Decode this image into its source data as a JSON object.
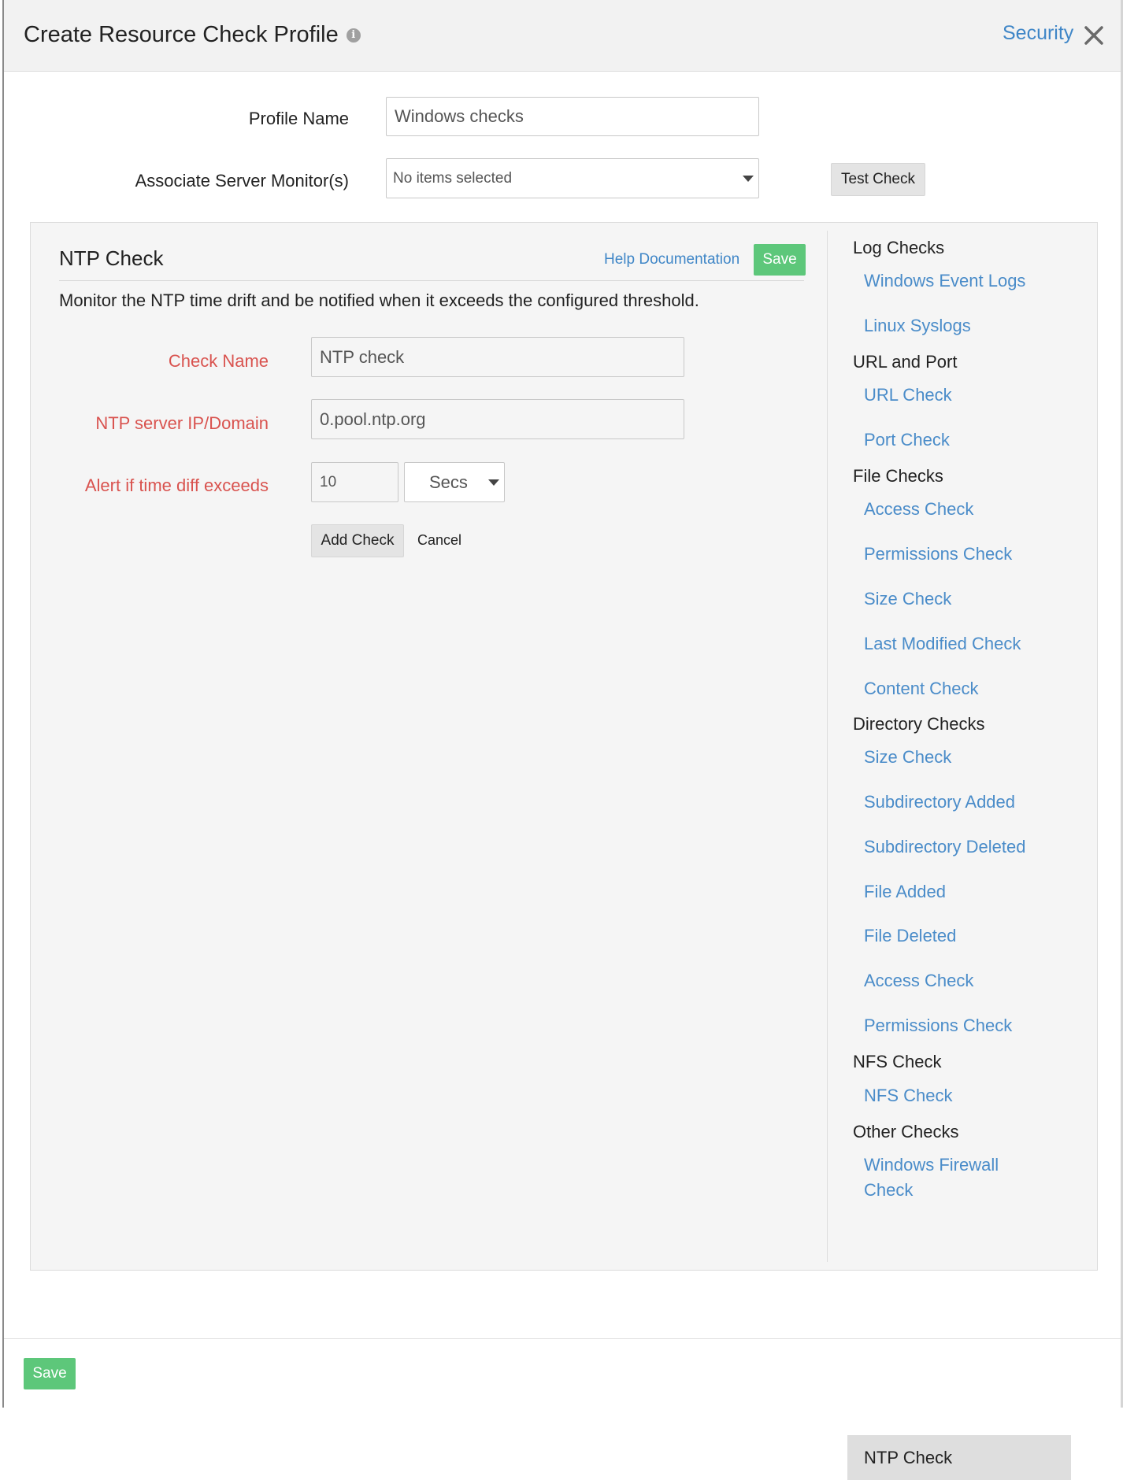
{
  "header": {
    "title": "Create Resource Check Profile",
    "info_icon": "i",
    "link": "Security"
  },
  "form": {
    "profile_name_label": "Profile Name",
    "profile_name_value": "Windows checks",
    "associate_label": "Associate Server Monitor(s)",
    "associate_value": "No items selected",
    "test_check_label": "Test Check"
  },
  "panel": {
    "title": "NTP Check",
    "help_link": "Help Documentation",
    "save_label": "Save",
    "description": "Monitor the NTP time drift and be notified when it exceeds the configured threshold.",
    "check_name_label": "Check Name",
    "check_name_value": "NTP check",
    "server_label": "NTP server IP/Domain",
    "server_value": "0.pool.ntp.org",
    "alert_label": "Alert if time diff exceeds",
    "alert_value": "10",
    "unit_value": "Secs",
    "add_check_label": "Add Check",
    "cancel_label": "Cancel"
  },
  "sidebar": {
    "groups": [
      {
        "label": "Log Checks",
        "items": [
          "Windows Event Logs",
          "Linux Syslogs"
        ]
      },
      {
        "label": "URL and Port",
        "items": [
          "URL Check",
          "Port Check"
        ]
      },
      {
        "label": "File Checks",
        "items": [
          "Access Check",
          "Permissions Check",
          "Size Check",
          "Last Modified Check",
          "Content Check"
        ]
      },
      {
        "label": "Directory Checks",
        "items": [
          "Size Check",
          "Subdirectory Added",
          "Subdirectory Deleted",
          "File Added",
          "File Deleted",
          "Access Check",
          "Permissions Check"
        ]
      },
      {
        "label": "NFS Check",
        "items": [
          "NFS Check"
        ]
      },
      {
        "label": "Other Checks",
        "items": [
          "Windows Firewall Check",
          "NTP Check"
        ]
      }
    ],
    "active_item": "NTP Check"
  },
  "footer": {
    "save_label": "Save"
  },
  "colors": {
    "accent_link": "#4a8cc9",
    "save_green": "#5dc77a",
    "required_red": "#d9534f"
  },
  "icons": {
    "info": "info-icon",
    "close": "close-icon",
    "dropdown": "caret-down-icon"
  }
}
